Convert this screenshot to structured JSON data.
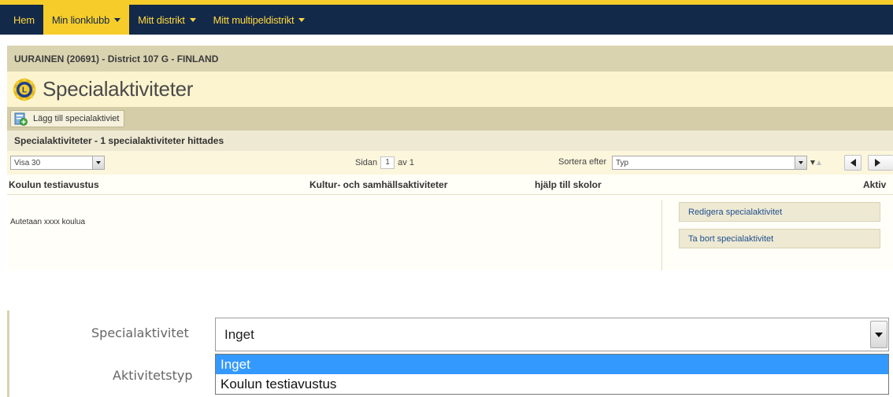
{
  "nav": {
    "items": [
      {
        "label": "Hem",
        "dropdown": false,
        "active": false
      },
      {
        "label": "Min lionklubb",
        "dropdown": true,
        "active": true
      },
      {
        "label": "Mitt distrikt",
        "dropdown": true,
        "active": false
      },
      {
        "label": "Mitt multipeldistrikt",
        "dropdown": true,
        "active": false
      }
    ]
  },
  "club": {
    "header": "UURAINEN (20691) - District 107 G - FINLAND"
  },
  "page": {
    "title": "Specialaktiviteter"
  },
  "toolbar": {
    "add_label": "Lägg till specialaktiviet"
  },
  "results": {
    "summary": "Specialaktiviteter - 1 specialaktiviteter hittades"
  },
  "controls": {
    "show_value": "Visa 30",
    "page_label": "Sidan",
    "page_current": "1",
    "page_of": "av 1",
    "sort_label": "Sortera efter",
    "sort_value": "Typ"
  },
  "table": {
    "columns": [
      "Koulun testiavustus",
      "Kultur- och samhällsaktiviteter",
      "hjälp till skolor",
      "Aktiv"
    ],
    "rows": [
      {
        "description": "Autetaan xxxx koulua"
      }
    ],
    "actions": {
      "edit_label": "Redigera specialaktivitet",
      "delete_label": "Ta bort specialaktivitet"
    }
  },
  "form": {
    "special_label": "Specialaktivitet",
    "special_value": "Inget",
    "type_label": "Aktivitetstyp",
    "options": [
      "Inget",
      "Koulun testiavustus"
    ],
    "selected_option": "Inget"
  },
  "colors": {
    "nav_bg": "#13294a",
    "nav_accent": "#f6cc2b",
    "link": "#1f4f8f",
    "option_highlight": "#3399ff"
  }
}
